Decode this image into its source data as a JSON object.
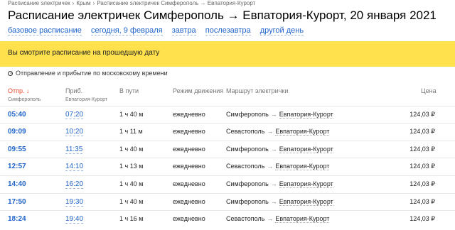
{
  "breadcrumb": [
    "Расписание электричек",
    "Крым",
    "Расписание электричек Симферополь → Евпатория-Курорт"
  ],
  "title": "Расписание электричек Симферополь → Евпатория-Курорт, 20 января 2021",
  "date_links": [
    "базовое расписание",
    "сегодня, 9 февраля",
    "завтра",
    "послезавтра",
    "другой день"
  ],
  "banner": "Вы смотрите расписание на прошедшую дату",
  "time_note": "Отправление и прибытие по московскому времени",
  "columns": {
    "departure": "Отпр. ↓",
    "departure_sub": "Симферополь",
    "arrival": "Приб.",
    "arrival_sub": "Евпатория-Курорт",
    "duration": "В пути",
    "mode": "Режим движения",
    "route": "Маршрут электрички",
    "price": "Цена"
  },
  "rows": [
    {
      "dep": "05:40",
      "arr": "07:20",
      "dur": "1 ч 40 м",
      "mode": "ежедневно",
      "from": "Симферополь",
      "to": "Евпатория-Курорт",
      "price": "124,03 ₽"
    },
    {
      "dep": "09:09",
      "arr": "10:20",
      "dur": "1 ч 11 м",
      "mode": "ежедневно",
      "from": "Севастополь",
      "to": "Евпатория-Курорт",
      "price": "124,03 ₽"
    },
    {
      "dep": "09:55",
      "arr": "11:35",
      "dur": "1 ч 40 м",
      "mode": "ежедневно",
      "from": "Симферополь",
      "to": "Евпатория-Курорт",
      "price": "124,03 ₽"
    },
    {
      "dep": "12:57",
      "arr": "14:10",
      "dur": "1 ч 13 м",
      "mode": "ежедневно",
      "from": "Севастополь",
      "to": "Евпатория-Курорт",
      "price": "124,03 ₽"
    },
    {
      "dep": "14:40",
      "arr": "16:20",
      "dur": "1 ч 40 м",
      "mode": "ежедневно",
      "from": "Симферополь",
      "to": "Евпатория-Курорт",
      "price": "124,03 ₽"
    },
    {
      "dep": "17:50",
      "arr": "19:30",
      "dur": "1 ч 40 м",
      "mode": "ежедневно",
      "from": "Симферополь",
      "to": "Евпатория-Курорт",
      "price": "124,03 ₽"
    },
    {
      "dep": "18:24",
      "arr": "19:40",
      "dur": "1 ч 16 м",
      "mode": "ежедневно",
      "from": "Севастополь",
      "to": "Евпатория-Курорт",
      "price": "124,03 ₽"
    }
  ],
  "colors": {
    "accent": "#1f63c9",
    "banner": "#ffe14d",
    "sort": "#e8412a"
  }
}
